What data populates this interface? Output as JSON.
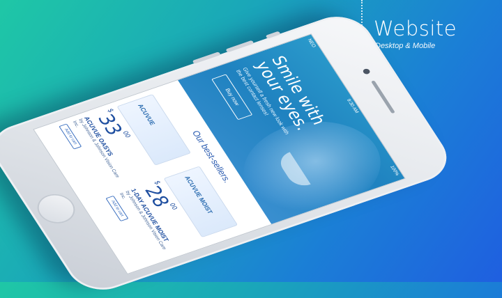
{
  "header": {
    "title": "Website",
    "subtitle": "Desktop & Mobile"
  },
  "status": {
    "carrier": "NEO",
    "time": "9:30 AM",
    "battery": "100%"
  },
  "hero": {
    "headline_line1": "Smile with",
    "headline_line2": "your eyes.",
    "body": "Give yourself a fresh new look with the best contact lenses!",
    "cta": "Buy now"
  },
  "bestsellers": {
    "title": "Our best-sellers.",
    "products": [
      {
        "box_logo": "ACUVUE",
        "currency": "$",
        "price": "33",
        "cents": "00",
        "name": "ACUVUE OASYS",
        "maker": "by Johnson & Johnson Vision Care Inc.",
        "button": "Add to cart"
      },
      {
        "box_logo": "ACUVUE MOIST",
        "currency": "$",
        "price": "28",
        "cents": "00",
        "name": "1-DAY ACUVUE MOIST",
        "maker": "by Johnson & Johnson Vision Care Inc.",
        "button": "Add to cart"
      }
    ]
  }
}
